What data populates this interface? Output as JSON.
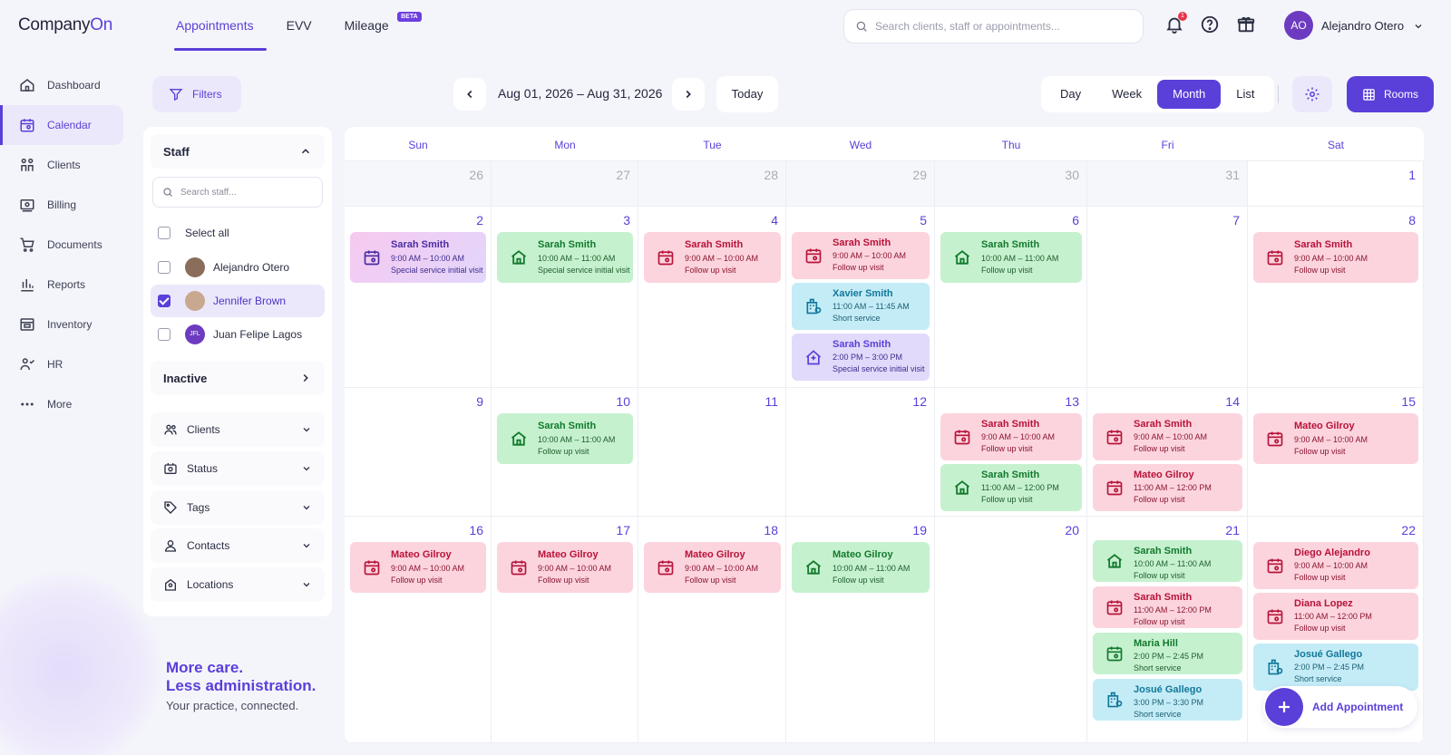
{
  "app": {
    "logo_main": "Company",
    "logo_accent": "On"
  },
  "top_tabs": [
    {
      "label": "Appointments",
      "active": true
    },
    {
      "label": "EVV",
      "active": false
    },
    {
      "label": "Mileage",
      "active": false,
      "badge": "BETA"
    }
  ],
  "search": {
    "placeholder": "Search clients, staff or appointments..."
  },
  "notifications": {
    "count": "1"
  },
  "user": {
    "initials": "AO",
    "name": "Alejandro Otero"
  },
  "sidebar": {
    "items": [
      {
        "label": "Dashboard",
        "icon": "home-icon",
        "active": false
      },
      {
        "label": "Calendar",
        "icon": "calendar-icon",
        "active": true
      },
      {
        "label": "Clients",
        "icon": "people-icon",
        "active": false
      },
      {
        "label": "Billing",
        "icon": "billing-icon",
        "active": false
      },
      {
        "label": "Documents",
        "icon": "cart-icon",
        "active": false
      },
      {
        "label": "Reports",
        "icon": "bar-chart-icon",
        "active": false
      },
      {
        "label": "Inventory",
        "icon": "inventory-icon",
        "active": false
      },
      {
        "label": "HR",
        "icon": "hr-icon",
        "active": false
      },
      {
        "label": "More",
        "icon": "more-dots-icon",
        "active": false
      }
    ]
  },
  "filters": {
    "button_label": "Filters",
    "staff_title": "Staff",
    "staff_search_placeholder": "Search staff...",
    "select_all": "Select all",
    "staff": [
      {
        "name": "Alejandro Otero",
        "checked": false,
        "avatar": "photo"
      },
      {
        "name": "Jennifer Brown",
        "checked": true,
        "avatar": "photo"
      },
      {
        "name": "Juan Felipe Lagos",
        "checked": false,
        "avatar": "JFL"
      }
    ],
    "inactive_label": "Inactive",
    "facets": [
      {
        "label": "Clients",
        "icon": "people-icon"
      },
      {
        "label": "Status",
        "icon": "status-icon"
      },
      {
        "label": "Tags",
        "icon": "tag-icon"
      },
      {
        "label": "Contacts",
        "icon": "contact-icon"
      },
      {
        "label": "Locations",
        "icon": "location-icon"
      }
    ]
  },
  "promo": {
    "line1": "More care.",
    "line2": "Less administration.",
    "line3": "Your practice, connected."
  },
  "toolbar": {
    "date_range": "Aug 01, 2026 – Aug 31, 2026",
    "today": "Today",
    "views": [
      {
        "label": "Day",
        "active": false
      },
      {
        "label": "Week",
        "active": false
      },
      {
        "label": "Month",
        "active": true
      },
      {
        "label": "List",
        "active": false
      }
    ],
    "rooms": "Rooms"
  },
  "calendar": {
    "weekdays": [
      "Sun",
      "Mon",
      "Tue",
      "Wed",
      "Thu",
      "Fri",
      "Sat"
    ],
    "weeks": [
      [
        {
          "day": "26",
          "out": true
        },
        {
          "day": "27",
          "out": true
        },
        {
          "day": "28",
          "out": true
        },
        {
          "day": "29",
          "out": true
        },
        {
          "day": "30",
          "out": true
        },
        {
          "day": "31",
          "out": true
        },
        {
          "day": "1",
          "out": false
        }
      ],
      [
        {
          "day": "2",
          "appts": [
            {
              "name": "Sarah Smith",
              "time": "9:00 AM – 10:00 AM",
              "service": "Special service initial visit",
              "color": "magenta",
              "icon": "calendar-icon"
            }
          ]
        },
        {
          "day": "3",
          "appts": [
            {
              "name": "Sarah Smith",
              "time": "10:00 AM – 11:00 AM",
              "service": "Special service initial visit",
              "color": "green",
              "icon": "home-icon"
            }
          ]
        },
        {
          "day": "4",
          "appts": [
            {
              "name": "Sarah Smith",
              "time": "9:00 AM – 10:00 AM",
              "service": "Follow up visit",
              "color": "pink",
              "icon": "calendar-icon"
            }
          ]
        },
        {
          "day": "5",
          "appts": [
            {
              "name": "Sarah Smith",
              "time": "9:00 AM – 10:00 AM",
              "service": "Follow up visit",
              "color": "pink",
              "icon": "calendar-icon"
            },
            {
              "name": "Xavier Smith",
              "time": "11:00 AM – 11:45 AM",
              "service": "Short service",
              "color": "cyan",
              "icon": "building-icon"
            },
            {
              "name": "Sarah Smith",
              "time": "2:00 PM – 3:00 PM",
              "service": "Special service initial visit",
              "color": "purple",
              "icon": "clinic-icon"
            }
          ]
        },
        {
          "day": "6",
          "appts": [
            {
              "name": "Sarah Smith",
              "time": "10:00 AM – 11:00 AM",
              "service": "Follow up visit",
              "color": "green",
              "icon": "home-icon"
            }
          ]
        },
        {
          "day": "7",
          "appts": []
        },
        {
          "day": "8",
          "appts": [
            {
              "name": "Sarah Smith",
              "time": "9:00 AM – 10:00 AM",
              "service": "Follow up visit",
              "color": "pink",
              "icon": "calendar-icon"
            }
          ]
        }
      ],
      [
        {
          "day": "9",
          "appts": []
        },
        {
          "day": "10",
          "appts": [
            {
              "name": "Sarah Smith",
              "time": "10:00 AM – 11:00 AM",
              "service": "Follow up visit",
              "color": "green",
              "icon": "home-icon"
            }
          ]
        },
        {
          "day": "11",
          "appts": []
        },
        {
          "day": "12",
          "appts": []
        },
        {
          "day": "13",
          "appts": [
            {
              "name": "Sarah Smith",
              "time": "9:00 AM – 10:00 AM",
              "service": "Follow up visit",
              "color": "pink",
              "icon": "calendar-icon"
            },
            {
              "name": "Sarah Smith",
              "time": "11:00 AM – 12:00 PM",
              "service": "Follow up visit",
              "color": "green",
              "icon": "home-icon"
            }
          ]
        },
        {
          "day": "14",
          "appts": [
            {
              "name": "Sarah Smith",
              "time": "9:00 AM – 10:00 AM",
              "service": "Follow up visit",
              "color": "pink",
              "icon": "calendar-icon"
            },
            {
              "name": "Mateo Gilroy",
              "time": "11:00 AM – 12:00 PM",
              "service": "Follow up visit",
              "color": "pink",
              "icon": "calendar-icon"
            }
          ]
        },
        {
          "day": "15",
          "appts": [
            {
              "name": "Mateo Gilroy",
              "time": "9:00 AM – 10:00 AM",
              "service": "Follow up visit",
              "color": "pink",
              "icon": "calendar-icon"
            }
          ]
        }
      ],
      [
        {
          "day": "16",
          "appts": [
            {
              "name": "Mateo Gilroy",
              "time": "9:00 AM – 10:00 AM",
              "service": "Follow up visit",
              "color": "pink",
              "icon": "calendar-icon"
            }
          ]
        },
        {
          "day": "17",
          "appts": [
            {
              "name": "Mateo Gilroy",
              "time": "9:00 AM – 10:00 AM",
              "service": "Follow up visit",
              "color": "pink",
              "icon": "calendar-icon"
            }
          ]
        },
        {
          "day": "18",
          "appts": [
            {
              "name": "Mateo Gilroy",
              "time": "9:00 AM – 10:00 AM",
              "service": "Follow up visit",
              "color": "pink",
              "icon": "calendar-icon"
            }
          ]
        },
        {
          "day": "19",
          "appts": [
            {
              "name": "Mateo Gilroy",
              "time": "10:00 AM – 11:00 AM",
              "service": "Follow up visit",
              "color": "green",
              "icon": "home-icon"
            }
          ]
        },
        {
          "day": "20",
          "appts": []
        },
        {
          "day": "21",
          "appts": [
            {
              "name": "Sarah Smith",
              "time": "10:00 AM – 11:00 AM",
              "service": "Follow up visit",
              "color": "green",
              "icon": "home-icon"
            },
            {
              "name": "Sarah Smith",
              "time": "11:00 AM – 12:00 PM",
              "service": "Follow up visit",
              "color": "pink",
              "icon": "calendar-icon"
            },
            {
              "name": "Maria Hill",
              "time": "2:00 PM – 2:45 PM",
              "service": "Short service",
              "color": "green",
              "icon": "calendar-icon"
            },
            {
              "name": "Josué Gallego",
              "time": "3:00 PM – 3:30 PM",
              "service": "Short service",
              "color": "cyan",
              "icon": "building-icon"
            }
          ]
        },
        {
          "day": "22",
          "appts": [
            {
              "name": "Diego Alejandro",
              "time": "9:00 AM – 10:00 AM",
              "service": "Follow up visit",
              "color": "pink",
              "icon": "calendar-icon"
            },
            {
              "name": "Diana Lopez",
              "time": "11:00 AM – 12:00 PM",
              "service": "Follow up visit",
              "color": "pink",
              "icon": "calendar-icon"
            },
            {
              "name": "Josué Gallego",
              "time": "2:00 PM – 2:45 PM",
              "service": "Short service",
              "color": "cyan",
              "icon": "building-icon"
            }
          ]
        }
      ]
    ]
  },
  "add_appointment": "Add Appointment",
  "colors": {
    "accent": "#5b3fd9",
    "pink": "#fcd4dd",
    "green": "#c6f1cf",
    "cyan": "#c4ecf7",
    "purple": "#e1dafa"
  }
}
